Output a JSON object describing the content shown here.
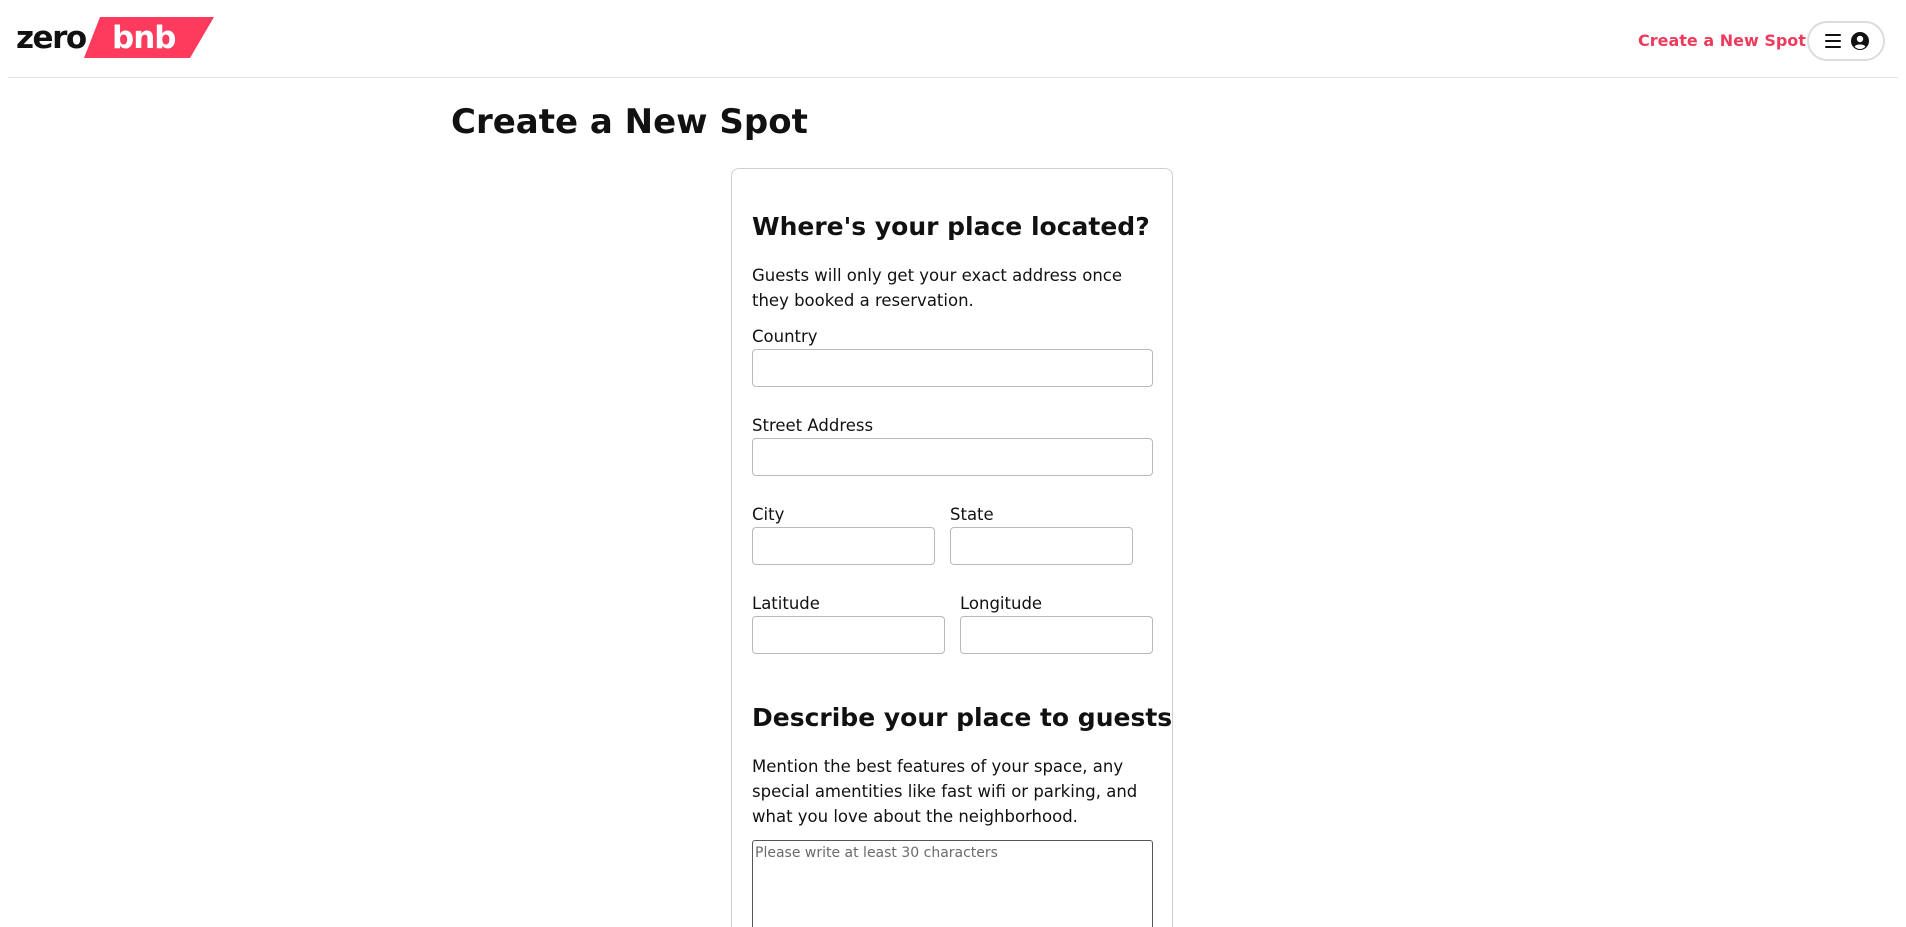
{
  "brand": {
    "name_part1": "zero",
    "name_part2": "bnb",
    "accent_color": "#ee3b5d",
    "badge_color": "#fe3b5c"
  },
  "nav": {
    "create_link": "Create a New Spot",
    "menu_icon": "hamburger-icon",
    "profile_icon": "user-circle-icon"
  },
  "page": {
    "title": "Create a New Spot"
  },
  "location_section": {
    "heading": "Where's your place located?",
    "description": "Guests will only get your exact address once they booked a reservation.",
    "fields": {
      "country": {
        "label": "Country",
        "value": ""
      },
      "street": {
        "label": "Street Address",
        "value": ""
      },
      "city": {
        "label": "City",
        "value": ""
      },
      "state": {
        "label": "State",
        "value": ""
      },
      "latitude": {
        "label": "Latitude",
        "value": ""
      },
      "longitude": {
        "label": "Longitude",
        "value": ""
      }
    }
  },
  "description_section": {
    "heading": "Describe your place to guests",
    "description": "Mention the best features of your space, any special amentities like fast wifi or parking, and what you love about the neighborhood.",
    "textarea_placeholder": "Please write at least 30 characters"
  }
}
